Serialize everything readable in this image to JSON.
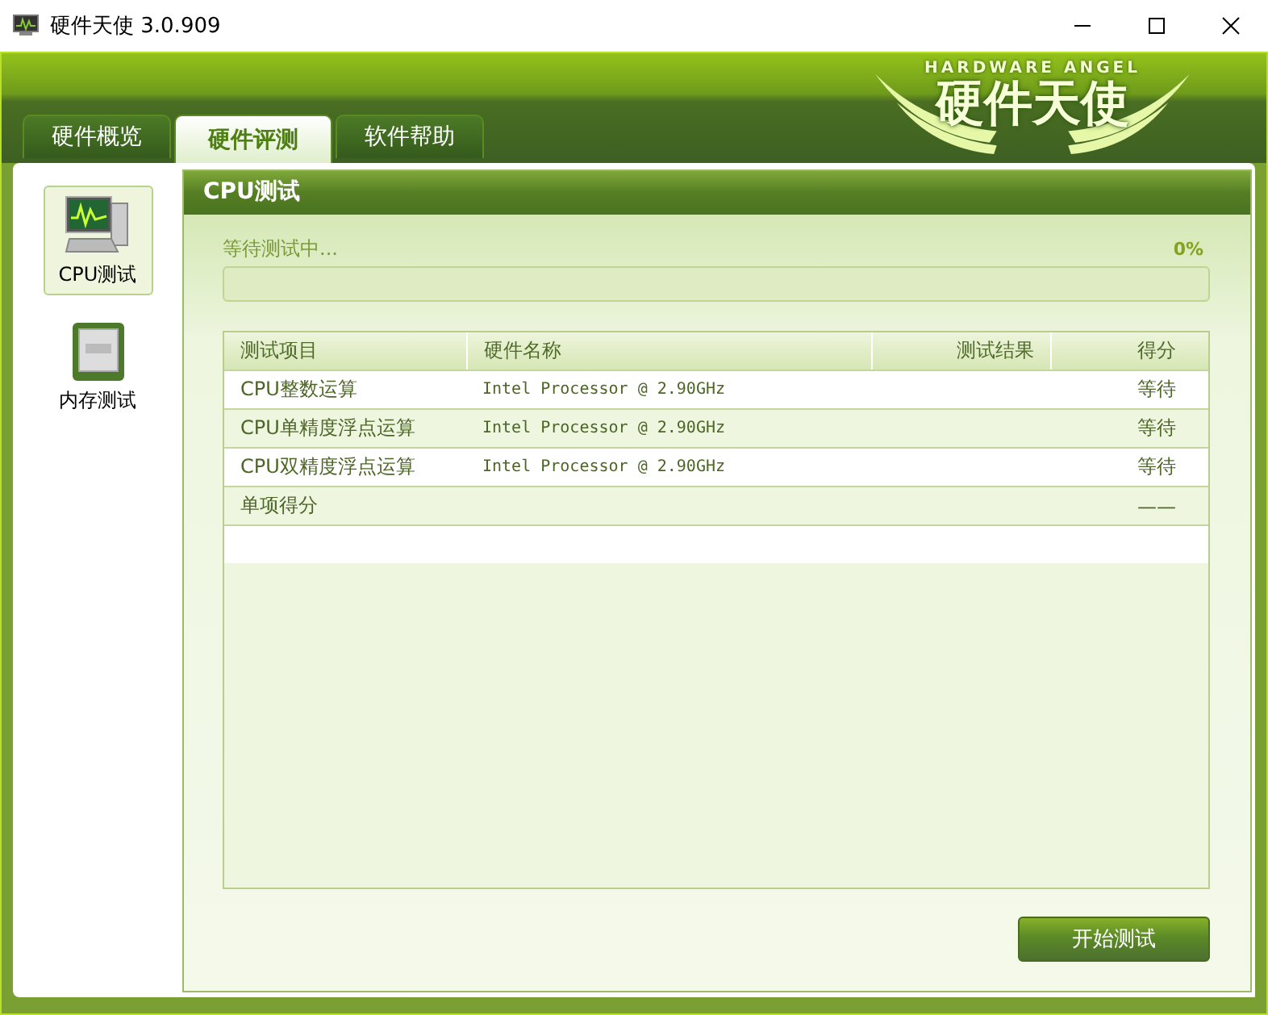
{
  "window": {
    "title": "硬件天使 3.0.909"
  },
  "logo": {
    "tagline": "HARDWARE ANGEL",
    "name": "硬件天使"
  },
  "tabs": [
    {
      "label": "硬件概览",
      "selected": false
    },
    {
      "label": "硬件评测",
      "selected": true
    },
    {
      "label": "软件帮助",
      "selected": false
    }
  ],
  "sidebar": {
    "items": [
      {
        "label": "CPU测试",
        "kind": "cpu",
        "selected": true
      },
      {
        "label": "内存测试",
        "kind": "memory",
        "selected": false
      }
    ]
  },
  "panel": {
    "title": "CPU测试",
    "status": "等待测试中...",
    "percent": "0%",
    "progress": {
      "level": 0
    }
  },
  "table": {
    "columns": [
      "测试项目",
      "硬件名称",
      "测试结果",
      "得分"
    ],
    "rows": [
      {
        "item": "CPU整数运算",
        "hardware": "Intel Processor @ 2.90GHz",
        "score": "等待"
      },
      {
        "item": "CPU单精度浮点运算",
        "hardware": "Intel Processor @ 2.90GHz",
        "score": "等待"
      },
      {
        "item": "CPU双精度浮点运算",
        "hardware": "Intel Processor @ 2.90GHz",
        "score": "等待"
      },
      {
        "item": "单项得分",
        "score": "——"
      }
    ]
  },
  "buttons": [
    {
      "label": "开始测试"
    }
  ]
}
